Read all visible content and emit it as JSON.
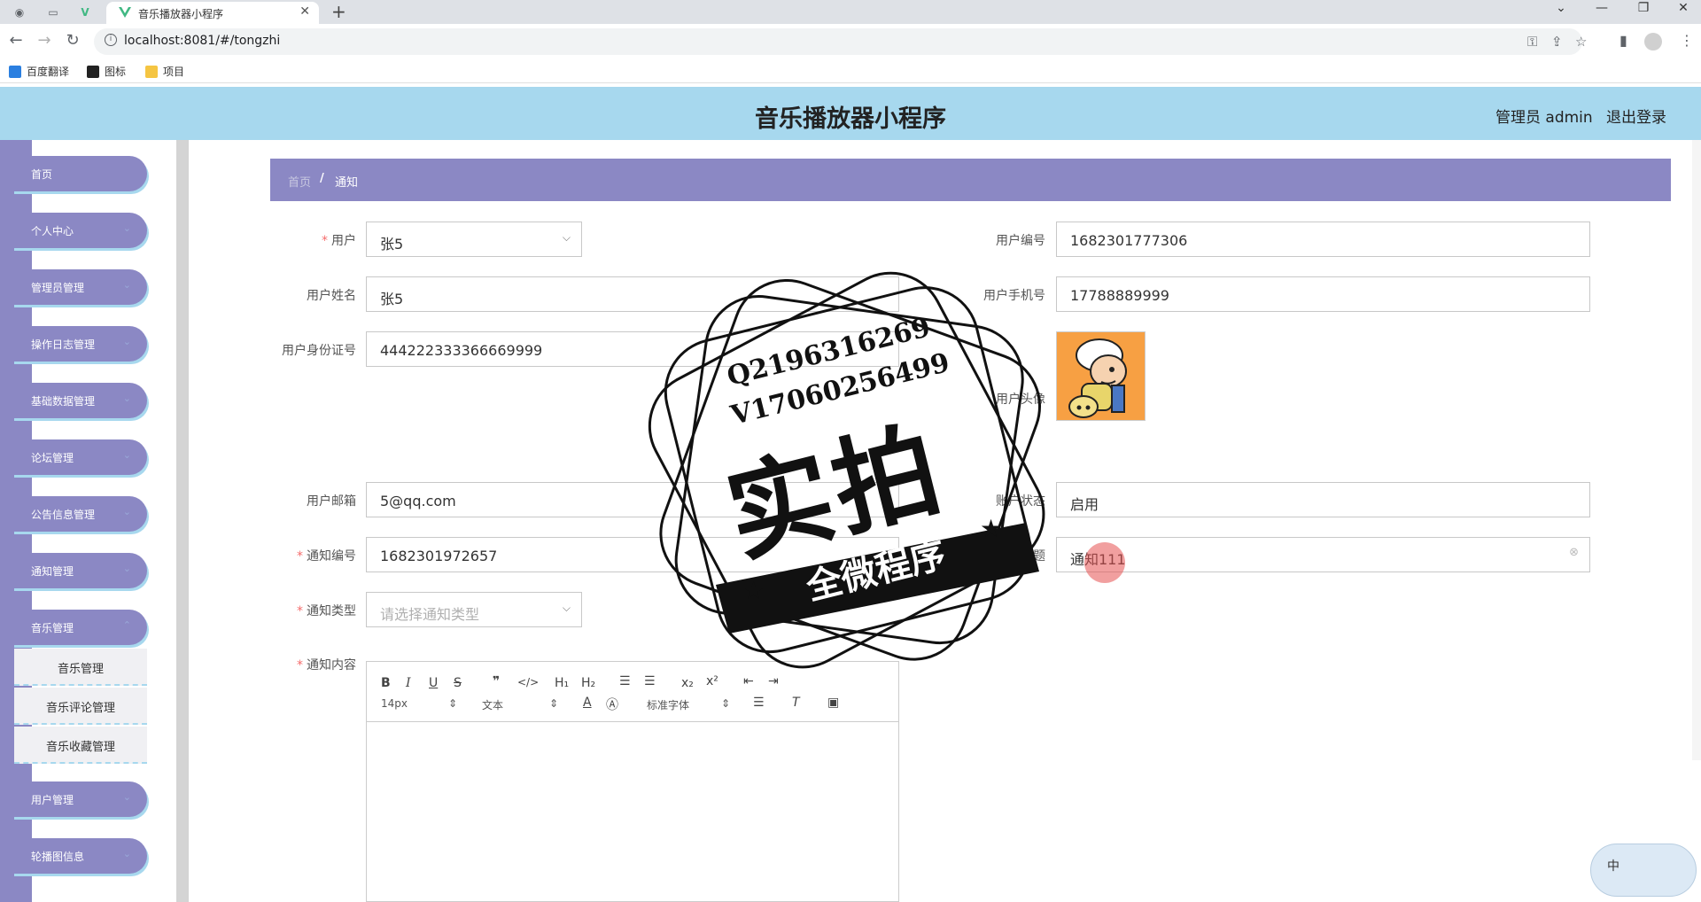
{
  "browser": {
    "tab_title": "音乐播放器小程序",
    "url": "localhost:8081/#/tongzhi",
    "bookmarks": [
      "百度翻译",
      "图标",
      "项目"
    ]
  },
  "header": {
    "title": "音乐播放器小程序",
    "admin": "管理员 admin",
    "logout": "退出登录"
  },
  "sidebar": {
    "items": [
      "首页",
      "个人中心",
      "管理员管理",
      "操作日志管理",
      "基础数据管理",
      "论坛管理",
      "公告信息管理",
      "通知管理",
      "音乐管理",
      "用户管理",
      "轮播图信息"
    ],
    "submenu": [
      "音乐管理",
      "音乐评论管理",
      "音乐收藏管理"
    ]
  },
  "breadcrumb": {
    "home": "首页",
    "separator": "/",
    "current": "通知"
  },
  "form": {
    "user_label": "用户",
    "user_value": "张5",
    "user_no_label": "用户编号",
    "user_no_value": "1682301777306",
    "user_name_label": "用户姓名",
    "user_name_value": "张5",
    "user_phone_label": "用户手机号",
    "user_phone_value": "17788889999",
    "id_card_label": "用户身份证号",
    "id_card_value": "444222333366669999",
    "avatar_label": "用户头像",
    "email_label": "用户邮箱",
    "email_value": "5@qq.com",
    "status_label": "账户状态",
    "status_value": "启用",
    "notice_no_label": "通知编号",
    "notice_no_value": "1682301972657",
    "notice_title_label": "通知标题",
    "notice_title_value": "通知111",
    "notice_type_label": "通知类型",
    "notice_type_placeholder": "请选择通知类型",
    "notice_content_label": "通知内容"
  },
  "editor": {
    "font_size": "14px",
    "paragraph": "文本",
    "font_family": "标准字体"
  },
  "watermark": {
    "line1": "Q2196316269",
    "line2": "V17060256499",
    "main": "实拍",
    "banner": "全微程序"
  },
  "ime": {
    "label": "中"
  },
  "colors": {
    "header": "#a7d8ee",
    "sidebar": "#8b88c4",
    "required": "#f56c6c"
  }
}
